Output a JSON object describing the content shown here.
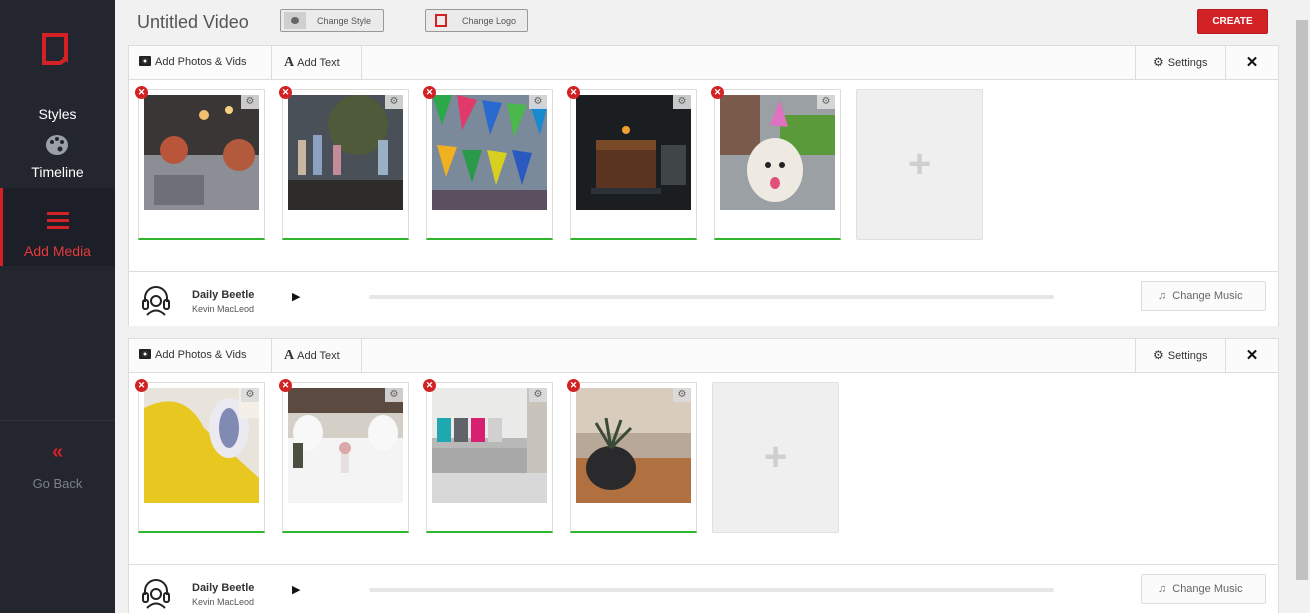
{
  "sidebar": {
    "styles_label": "Styles",
    "timeline_label": "Timeline",
    "add_media_label": "Add Media",
    "go_back_icon": "«",
    "go_back_label": "Go Back"
  },
  "header": {
    "title": "Untitled Video",
    "change_style_label": "Change Style",
    "change_logo_label": "Change Logo",
    "create_label": "CREATE"
  },
  "scene_toolbar": {
    "add_photos_label": "Add Photos & Vids",
    "add_text_label": "Add Text",
    "settings_label": "Settings",
    "close_glyph": "✕"
  },
  "scenes": [
    {
      "slides": [
        {
          "desc": "table with flower centerpieces and candles"
        },
        {
          "desc": "drinks table with tree"
        },
        {
          "desc": "colorful bunting flags"
        },
        {
          "desc": "chocolate cake with sparkler"
        },
        {
          "desc": "dog wearing party hat"
        }
      ],
      "music": {
        "title": "Daily Beetle",
        "artist": "Kevin MacLeod",
        "change_label": "Change Music"
      }
    },
    {
      "slides": [
        {
          "desc": "yellow chair with cushion"
        },
        {
          "desc": "white table with vase"
        },
        {
          "desc": "grey sofa with colorful pillows"
        },
        {
          "desc": "black vase with plant on wooden table"
        }
      ],
      "music": {
        "title": "Daily Beetle",
        "artist": "Kevin MacLeod",
        "change_label": "Change Music"
      }
    }
  ],
  "colors": {
    "accent": "#d32226",
    "sidebar_bg": "#23262f",
    "slide_ok": "#2fb52f"
  },
  "icons": {
    "play": "▶",
    "plus": "+",
    "remove": "✕",
    "cog": "⚙",
    "note": "♫"
  }
}
